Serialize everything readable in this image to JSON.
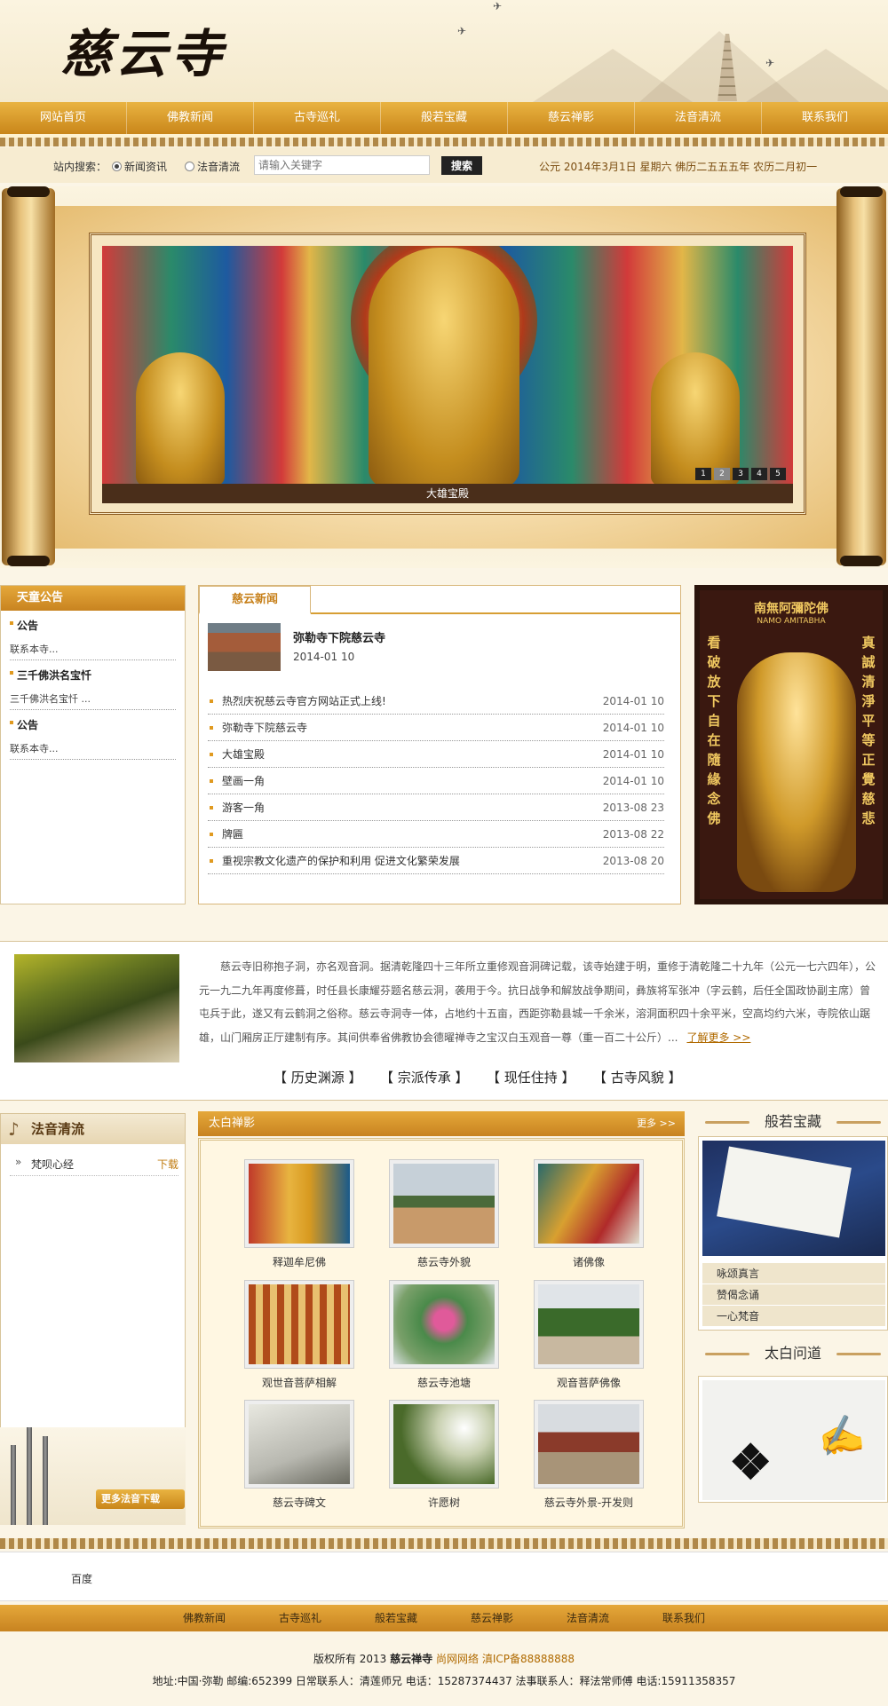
{
  "header": {
    "logo": "慈云寺"
  },
  "nav": [
    "网站首页",
    "佛教新闻",
    "古寺巡礼",
    "般若宝藏",
    "慈云禅影",
    "法音清流",
    "联系我们"
  ],
  "search": {
    "label": "站内搜索：",
    "options": [
      "新闻资讯",
      "法音清流"
    ],
    "selected": "新闻资讯",
    "placeholder": "请输入关键字",
    "button": "搜索",
    "date": "公元 2014年3月1日 星期六 佛历二五五五年 农历二月初一"
  },
  "banner": {
    "caption": "大雄宝殿",
    "slides": [
      "1",
      "2",
      "3",
      "4",
      "5"
    ],
    "active_slide": "2"
  },
  "notice": {
    "title": "天童公告",
    "items": [
      {
        "head": "公告",
        "text": "联系本寺..."
      },
      {
        "head": "三千佛洪名宝忏",
        "text": "三千佛洪名宝忏 ..."
      },
      {
        "head": "公告",
        "text": "联系本寺..."
      }
    ]
  },
  "news": {
    "tab": "慈云新闻",
    "feature": {
      "title": "弥勒寺下院慈云寺",
      "date": "2014-01 10"
    },
    "items": [
      {
        "title": "热烈庆祝慈云寺官方网站正式上线!",
        "date": "2014-01 10"
      },
      {
        "title": "弥勒寺下院慈云寺",
        "date": "2014-01 10"
      },
      {
        "title": "大雄宝殿",
        "date": "2014-01 10"
      },
      {
        "title": "壁画一角",
        "date": "2014-01 10"
      },
      {
        "title": "游客一角",
        "date": "2013-08 23"
      },
      {
        "title": "牌匾",
        "date": "2013-08 22"
      },
      {
        "title": "重视宗教文化遗产的保护和利用 促进文化繁荣发展",
        "date": "2013-08 20"
      }
    ]
  },
  "amitabha": {
    "title": "南無阿彌陀佛",
    "subtitle": "NAMO AMITABHA",
    "left_text": "看破放下自在隨緣念佛",
    "right_text": "真誠清淨平等正覺慈悲"
  },
  "intro": {
    "text": "慈云寺旧称抱子洞，亦名观音洞。据清乾隆四十三年所立重修观音洞碑记载，该寺始建于明，重修于清乾隆二十九年（公元一七六四年），公元一九二九年再度修葺，时任县长康耀芬题名慈云洞，袭用于今。抗日战争和解放战争期间，彝族将军张冲（字云鹤，后任全国政协副主席）曾屯兵于此，遂又有云鹤洞之俗称。慈云寺洞寺一体，占地约十五亩，西距弥勒县城一千余米，溶洞面积四十余平米，空高均约六米，寺院依山踞雄，山门厢房正厅建制有序。其间供奉省佛教协会德曜禅寺之宝汉白玉观音一尊（重一百二十公斤）...",
    "more": "了解更多 >>",
    "links": [
      "【 历史渊源 】",
      "【 宗派传承 】",
      "【 现任住持 】",
      "【 古寺风貌 】"
    ]
  },
  "audio": {
    "title": "法音清流",
    "items": [
      {
        "name": "梵呗心经",
        "action": "下载"
      }
    ],
    "more_button": "更多法音下载"
  },
  "gallery": {
    "title": "太白禅影",
    "more": "更多 >>",
    "items": [
      "释迦牟尼佛",
      "慈云寺外貌",
      "诸佛像",
      "观世音菩萨相解",
      "慈云寺池塘",
      "观音菩萨佛像",
      "慈云寺碑文",
      "许愿树",
      "慈云寺外景-开发则"
    ]
  },
  "scripture": {
    "title": "般若宝藏",
    "items": [
      "咏颂真言",
      "赞偈念诵",
      "一心梵音"
    ]
  },
  "calligraphy": {
    "title": "太白问道"
  },
  "links": {
    "friend": "百度"
  },
  "footer": {
    "nav": [
      "佛教新闻",
      "古寺巡礼",
      "般若宝藏",
      "慈云禅影",
      "法音清流",
      "联系我们"
    ],
    "copyright_prefix": "版权所有 2013",
    "temple": "慈云禅寺",
    "network": "尚网网络",
    "icp": "滇ICP备88888888",
    "address": "地址:中国·弥勒 邮编:652399 日常联系人：清莲师兄 电话：15287374437 法事联系人：释法常师傅 电话:15911358357"
  }
}
